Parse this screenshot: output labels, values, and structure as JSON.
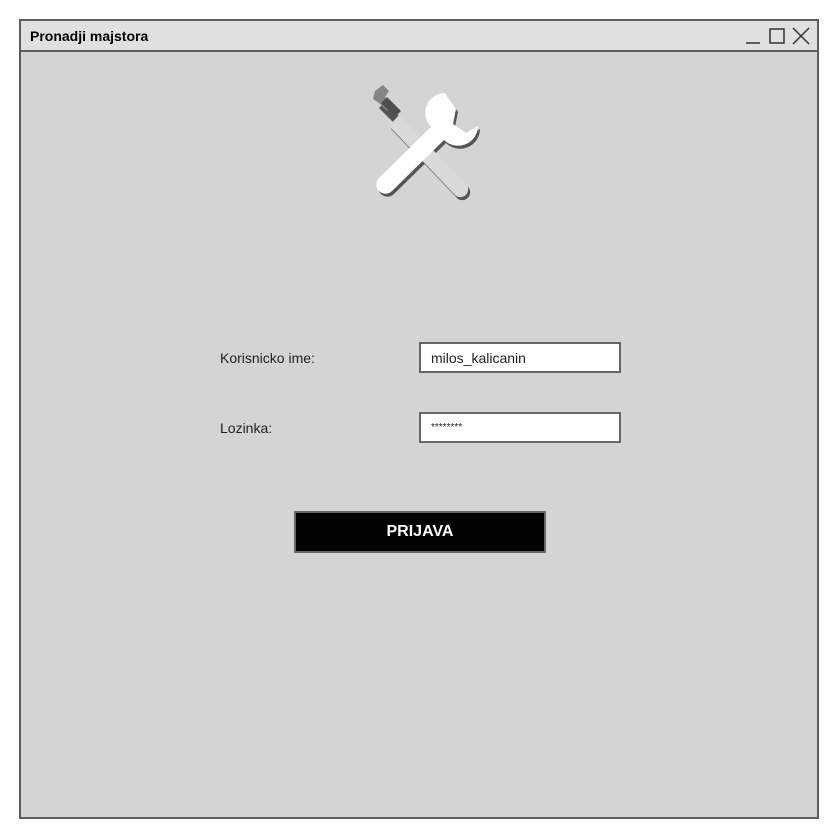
{
  "window": {
    "title": "Pronadji majstora",
    "controls": {
      "minimize_icon": "minimize-icon",
      "maximize_icon": "maximize-icon",
      "close_icon": "close-icon"
    }
  },
  "logo": {
    "icon": "tools-icon"
  },
  "form": {
    "username_label": "Korisnicko ime:",
    "username_value": "milos_kalicanin",
    "password_label": "Lozinka:",
    "password_value": "********",
    "submit_label": "PRIJAVA"
  },
  "colors": {
    "background": "#d4d4d4",
    "titlebar": "#e0e0e0",
    "button": "#000000",
    "button_text": "#ffffff"
  }
}
